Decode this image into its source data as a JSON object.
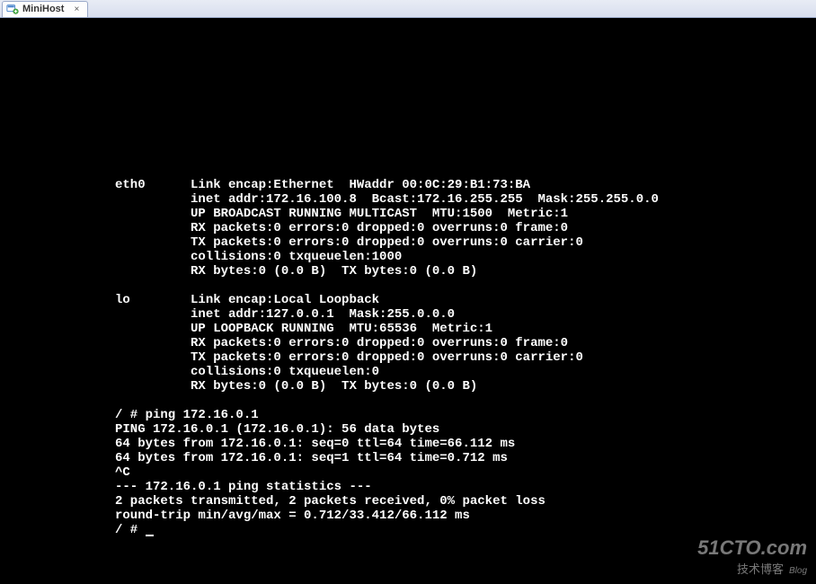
{
  "tab": {
    "label": "MiniHost",
    "close_glyph": "×"
  },
  "terminal": {
    "lines": [
      "eth0      Link encap:Ethernet  HWaddr 00:0C:29:B1:73:BA",
      "          inet addr:172.16.100.8  Bcast:172.16.255.255  Mask:255.255.0.0",
      "          UP BROADCAST RUNNING MULTICAST  MTU:1500  Metric:1",
      "          RX packets:0 errors:0 dropped:0 overruns:0 frame:0",
      "          TX packets:0 errors:0 dropped:0 overruns:0 carrier:0",
      "          collisions:0 txqueuelen:1000",
      "          RX bytes:0 (0.0 B)  TX bytes:0 (0.0 B)",
      "",
      "lo        Link encap:Local Loopback",
      "          inet addr:127.0.0.1  Mask:255.0.0.0",
      "          UP LOOPBACK RUNNING  MTU:65536  Metric:1",
      "          RX packets:0 errors:0 dropped:0 overruns:0 frame:0",
      "          TX packets:0 errors:0 dropped:0 overruns:0 carrier:0",
      "          collisions:0 txqueuelen:0",
      "          RX bytes:0 (0.0 B)  TX bytes:0 (0.0 B)",
      "",
      "/ # ping 172.16.0.1",
      "PING 172.16.0.1 (172.16.0.1): 56 data bytes",
      "64 bytes from 172.16.0.1: seq=0 ttl=64 time=66.112 ms",
      "64 bytes from 172.16.0.1: seq=1 ttl=64 time=0.712 ms",
      "^C",
      "--- 172.16.0.1 ping statistics ---",
      "2 packets transmitted, 2 packets received, 0% packet loss",
      "round-trip min/avg/max = 0.712/33.412/66.112 ms"
    ],
    "prompt": "/ # "
  },
  "watermark": {
    "main": "51CTO.com",
    "sub": "技术博客",
    "blog": "Blog"
  }
}
